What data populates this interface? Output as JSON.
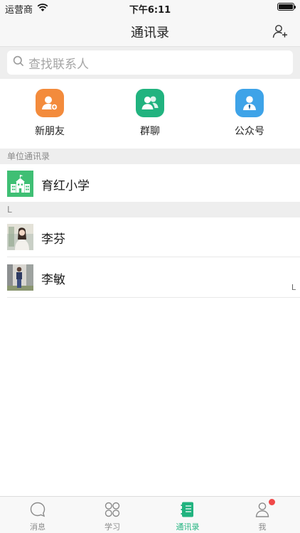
{
  "status_bar": {
    "carrier": "运营商",
    "time": "下午6:11"
  },
  "nav": {
    "title": "通讯录",
    "add_icon": "add-contact-icon"
  },
  "search": {
    "placeholder": "查找联系人"
  },
  "quick_actions": [
    {
      "label": "新朋友",
      "icon": "new-friend-icon",
      "color": "#f38b3c"
    },
    {
      "label": "群聊",
      "icon": "group-chat-icon",
      "color": "#21b37f"
    },
    {
      "label": "公众号",
      "icon": "official-account-icon",
      "color": "#3ea3e8"
    }
  ],
  "sections": [
    {
      "header": "单位通讯录",
      "rows": [
        {
          "name": "育红小学",
          "avatar": "school-icon"
        }
      ]
    },
    {
      "header": "L",
      "rows": [
        {
          "name": "李芬",
          "avatar": "photo-avatar"
        },
        {
          "name": "李敏",
          "avatar": "photo-avatar"
        }
      ]
    }
  ],
  "index_letters": [
    "L"
  ],
  "tabs": [
    {
      "label": "消息",
      "icon": "message-icon",
      "active": false
    },
    {
      "label": "学习",
      "icon": "study-icon",
      "active": false
    },
    {
      "label": "通讯录",
      "icon": "contacts-book-icon",
      "active": true
    },
    {
      "label": "我",
      "icon": "profile-icon",
      "active": false,
      "badge": true
    }
  ],
  "colors": {
    "accent": "#21b37f",
    "badge": "#f04848",
    "school_tile": "#3fbf74"
  }
}
